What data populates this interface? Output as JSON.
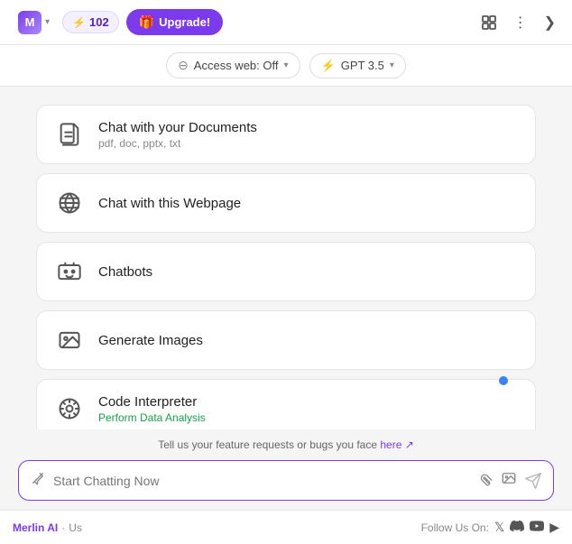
{
  "topbar": {
    "logo_alt": "Merlin AI",
    "credits": "102",
    "upgrade_label": "Upgrade!",
    "expand_icon": "⤢",
    "more_icon": "⋮",
    "forward_icon": "❯"
  },
  "secondbar": {
    "access_label": "Access web: Off",
    "access_icon": "🚫",
    "model_label": "GPT 3.5",
    "chevron": "▾"
  },
  "features": [
    {
      "id": "documents",
      "title": "Chat with your Documents",
      "subtitle": "pdf, doc, pptx, txt",
      "icon_name": "document-icon"
    },
    {
      "id": "webpage",
      "title": "Chat with this Webpage",
      "subtitle": "",
      "icon_name": "globe-icon"
    },
    {
      "id": "chatbots",
      "title": "Chatbots",
      "subtitle": "",
      "icon_name": "chatbot-icon"
    },
    {
      "id": "images",
      "title": "Generate Images",
      "subtitle": "",
      "icon_name": "image-icon"
    },
    {
      "id": "code",
      "title": "Code Interpreter",
      "subtitle": "Perform Data Analysis",
      "icon_name": "code-icon"
    }
  ],
  "feedback": {
    "text": "Tell us your feature requests or bugs you face",
    "link_label": "here ↗"
  },
  "chatinput": {
    "placeholder": "Start Chatting Now"
  },
  "bottombar": {
    "brand": "Merlin AI",
    "separator": "·",
    "suffix": "Us",
    "follow_label": "Follow Us On:",
    "twitter": "𝕏",
    "discord": "▶",
    "youtube": "▶"
  }
}
